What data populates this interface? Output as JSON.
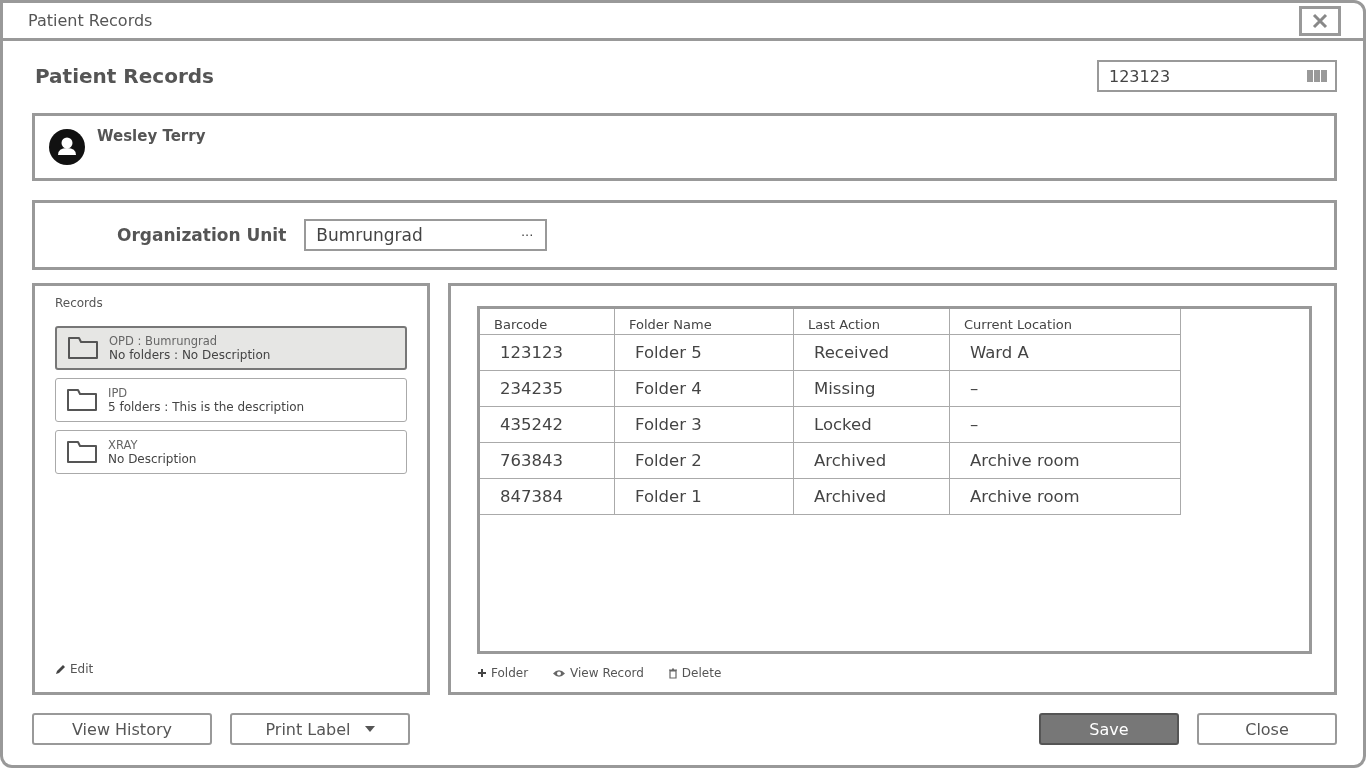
{
  "window": {
    "title": "Patient Records"
  },
  "header": {
    "title": "Patient Records",
    "barcode_field": {
      "value": "123123"
    }
  },
  "patient": {
    "name": "Wesley Terry"
  },
  "organization": {
    "label": "Organization Unit",
    "value": "Bumrungrad",
    "browse": "···"
  },
  "records": {
    "title": "Records",
    "items": [
      {
        "name": "OPD : Bumrungrad",
        "detail": "No folders : No Description",
        "selected": true
      },
      {
        "name": "IPD",
        "detail": "5 folders : This is the description",
        "selected": false
      },
      {
        "name": "XRAY",
        "detail": "No Description",
        "selected": false
      }
    ],
    "edit": "Edit"
  },
  "table": {
    "columns": [
      "Barcode",
      "Folder Name",
      "Last Action",
      "Current Location"
    ],
    "rows": [
      [
        "123123",
        "Folder 5",
        "Received",
        "Ward A"
      ],
      [
        "234235",
        "Folder 4",
        "Missing",
        "–"
      ],
      [
        "435242",
        "Folder 3",
        "Locked",
        "–"
      ],
      [
        "763843",
        "Folder 2",
        "Archived",
        "Archive room"
      ],
      [
        "847384",
        "Folder 1",
        "Archived",
        "Archive room"
      ]
    ],
    "actions": [
      {
        "kind": "add",
        "label": "Folder"
      },
      {
        "kind": "view",
        "label": "View Record"
      },
      {
        "kind": "delete",
        "label": "Delete"
      }
    ]
  },
  "footer": {
    "left": [
      {
        "label": "View History",
        "dropdown": false
      },
      {
        "label": "Print Label",
        "dropdown": true
      }
    ],
    "right": [
      {
        "label": "Save",
        "primary": true
      },
      {
        "label": "Close",
        "primary": false
      }
    ]
  }
}
